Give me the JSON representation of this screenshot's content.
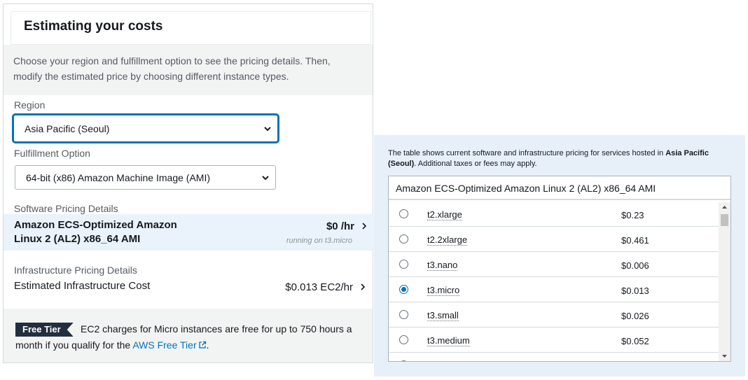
{
  "estimator": {
    "title": "Estimating your costs",
    "intro": "Choose your region and fulfillment option to see the pricing details. Then, modify the estimated price by choosing different instance types.",
    "region_label": "Region",
    "region_value": "Asia Pacific (Seoul)",
    "fulfillment_label": "Fulfillment Option",
    "fulfillment_value": "64-bit (x86) Amazon Machine Image (AMI)",
    "software_label": "Software Pricing Details",
    "software_name": "Amazon ECS-Optimized Amazon Linux 2 (AL2) x86_64 AMI",
    "software_price": "$0 /hr",
    "software_note": "running on t3.micro",
    "infra_label": "Infrastructure Pricing Details",
    "infra_name": "Estimated Infrastructure Cost",
    "infra_price": "$0.013 EC2/hr",
    "free_tier_badge": "Free Tier",
    "free_tier_text_1": "EC2 charges for Micro instances are free for up to 750 hours a",
    "free_tier_text_2": "month if you qualify for the ",
    "free_tier_link": "AWS Free Tier",
    "free_tier_end": "."
  },
  "pricing_table": {
    "note_prefix": "The table shows current software and infrastructure pricing for services hosted in ",
    "note_region": "Asia Pacific (Seoul)",
    "note_suffix": ". Additional taxes or fees may apply.",
    "header": "Amazon ECS-Optimized Amazon Linux 2 (AL2) x86_64 AMI",
    "rows": [
      {
        "type": "t2.xlarge",
        "price": "$0.23",
        "selected": false
      },
      {
        "type": "t2.2xlarge",
        "price": "$0.461",
        "selected": false
      },
      {
        "type": "t3.nano",
        "price": "$0.006",
        "selected": false
      },
      {
        "type": "t3.micro",
        "price": "$0.013",
        "selected": true
      },
      {
        "type": "t3.small",
        "price": "$0.026",
        "selected": false
      },
      {
        "type": "t3.medium",
        "price": "$0.052",
        "selected": false
      }
    ]
  },
  "colors": {
    "accent": "#0073bb",
    "highlight_bg": "#eaf3fb",
    "panel_bg": "#e7f0f9",
    "badge_bg": "#232f3e"
  }
}
